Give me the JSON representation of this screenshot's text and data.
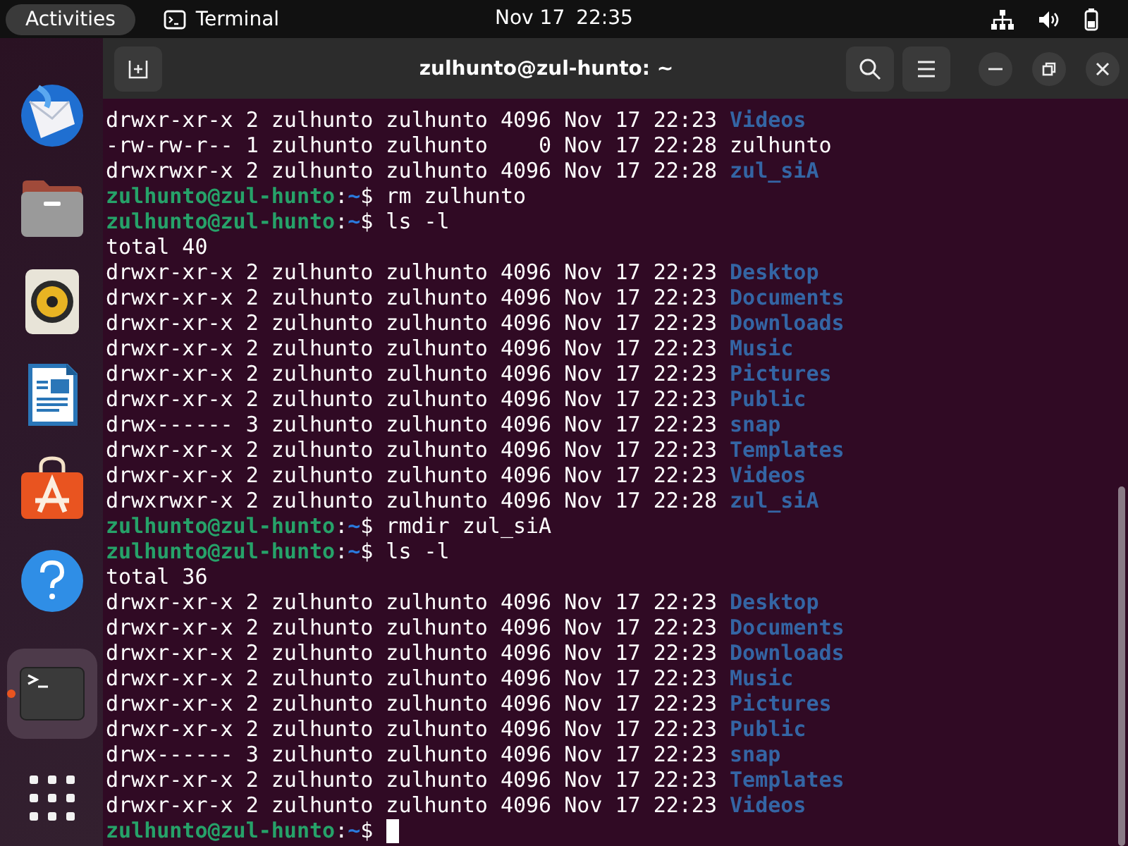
{
  "top_bar": {
    "activities": "Activities",
    "app_name": "Terminal",
    "date": "Nov 17",
    "time": "22:35"
  },
  "dock": {
    "apps": [
      {
        "kind": "mail",
        "running": false
      },
      {
        "kind": "files",
        "running": false
      },
      {
        "kind": "music",
        "running": false
      },
      {
        "kind": "writer",
        "running": false
      },
      {
        "kind": "store",
        "running": false
      },
      {
        "kind": "help",
        "running": false
      },
      {
        "kind": "terminal",
        "running": true
      },
      {
        "kind": "grid",
        "running": false
      }
    ]
  },
  "terminal": {
    "title": "zulhunto@zul-hunto: ~",
    "lines": [
      {
        "kind": "entry",
        "info": "drwxr-xr-x 2 zulhunto zulhunto 4096 Nov 17 22:23 ",
        "name": "Videos",
        "directory": true
      },
      {
        "kind": "entry",
        "info": "-rw-rw-r-- 1 zulhunto zulhunto    0 Nov 17 22:28 ",
        "name": "zulhunto",
        "directory": false
      },
      {
        "kind": "entry",
        "info": "drwxrwxr-x 2 zulhunto zulhunto 4096 Nov 17 22:28 ",
        "name": "zul_siA",
        "directory": true
      },
      {
        "kind": "prompt",
        "host": "zulhunto@zul-hunto",
        "separator": ":",
        "path": "~",
        "symbol": "$",
        "command": "rm zulhunto"
      },
      {
        "kind": "prompt",
        "host": "zulhunto@zul-hunto",
        "separator": ":",
        "path": "~",
        "symbol": "$",
        "command": "ls -l"
      },
      {
        "kind": "text",
        "text": "total 40"
      },
      {
        "kind": "entry",
        "info": "drwxr-xr-x 2 zulhunto zulhunto 4096 Nov 17 22:23 ",
        "name": "Desktop",
        "directory": true
      },
      {
        "kind": "entry",
        "info": "drwxr-xr-x 2 zulhunto zulhunto 4096 Nov 17 22:23 ",
        "name": "Documents",
        "directory": true
      },
      {
        "kind": "entry",
        "info": "drwxr-xr-x 2 zulhunto zulhunto 4096 Nov 17 22:23 ",
        "name": "Downloads",
        "directory": true
      },
      {
        "kind": "entry",
        "info": "drwxr-xr-x 2 zulhunto zulhunto 4096 Nov 17 22:23 ",
        "name": "Music",
        "directory": true
      },
      {
        "kind": "entry",
        "info": "drwxr-xr-x 2 zulhunto zulhunto 4096 Nov 17 22:23 ",
        "name": "Pictures",
        "directory": true
      },
      {
        "kind": "entry",
        "info": "drwxr-xr-x 2 zulhunto zulhunto 4096 Nov 17 22:23 ",
        "name": "Public",
        "directory": true
      },
      {
        "kind": "entry",
        "info": "drwx------ 3 zulhunto zulhunto 4096 Nov 17 22:23 ",
        "name": "snap",
        "directory": true
      },
      {
        "kind": "entry",
        "info": "drwxr-xr-x 2 zulhunto zulhunto 4096 Nov 17 22:23 ",
        "name": "Templates",
        "directory": true
      },
      {
        "kind": "entry",
        "info": "drwxr-xr-x 2 zulhunto zulhunto 4096 Nov 17 22:23 ",
        "name": "Videos",
        "directory": true
      },
      {
        "kind": "entry",
        "info": "drwxrwxr-x 2 zulhunto zulhunto 4096 Nov 17 22:28 ",
        "name": "zul_siA",
        "directory": true
      },
      {
        "kind": "prompt",
        "host": "zulhunto@zul-hunto",
        "separator": ":",
        "path": "~",
        "symbol": "$",
        "command": "rmdir zul_siA"
      },
      {
        "kind": "prompt",
        "host": "zulhunto@zul-hunto",
        "separator": ":",
        "path": "~",
        "symbol": "$",
        "command": "ls -l"
      },
      {
        "kind": "text",
        "text": "total 36"
      },
      {
        "kind": "entry",
        "info": "drwxr-xr-x 2 zulhunto zulhunto 4096 Nov 17 22:23 ",
        "name": "Desktop",
        "directory": true
      },
      {
        "kind": "entry",
        "info": "drwxr-xr-x 2 zulhunto zulhunto 4096 Nov 17 22:23 ",
        "name": "Documents",
        "directory": true
      },
      {
        "kind": "entry",
        "info": "drwxr-xr-x 2 zulhunto zulhunto 4096 Nov 17 22:23 ",
        "name": "Downloads",
        "directory": true
      },
      {
        "kind": "entry",
        "info": "drwxr-xr-x 2 zulhunto zulhunto 4096 Nov 17 22:23 ",
        "name": "Music",
        "directory": true
      },
      {
        "kind": "entry",
        "info": "drwxr-xr-x 2 zulhunto zulhunto 4096 Nov 17 22:23 ",
        "name": "Pictures",
        "directory": true
      },
      {
        "kind": "entry",
        "info": "drwxr-xr-x 2 zulhunto zulhunto 4096 Nov 17 22:23 ",
        "name": "Public",
        "directory": true
      },
      {
        "kind": "entry",
        "info": "drwx------ 3 zulhunto zulhunto 4096 Nov 17 22:23 ",
        "name": "snap",
        "directory": true
      },
      {
        "kind": "entry",
        "info": "drwxr-xr-x 2 zulhunto zulhunto 4096 Nov 17 22:23 ",
        "name": "Templates",
        "directory": true
      },
      {
        "kind": "entry",
        "info": "drwxr-xr-x 2 zulhunto zulhunto 4096 Nov 17 22:23 ",
        "name": "Videos",
        "directory": true
      },
      {
        "kind": "prompt",
        "host": "zulhunto@zul-hunto",
        "separator": ":",
        "path": "~",
        "symbol": "$",
        "cursor": true
      }
    ]
  }
}
